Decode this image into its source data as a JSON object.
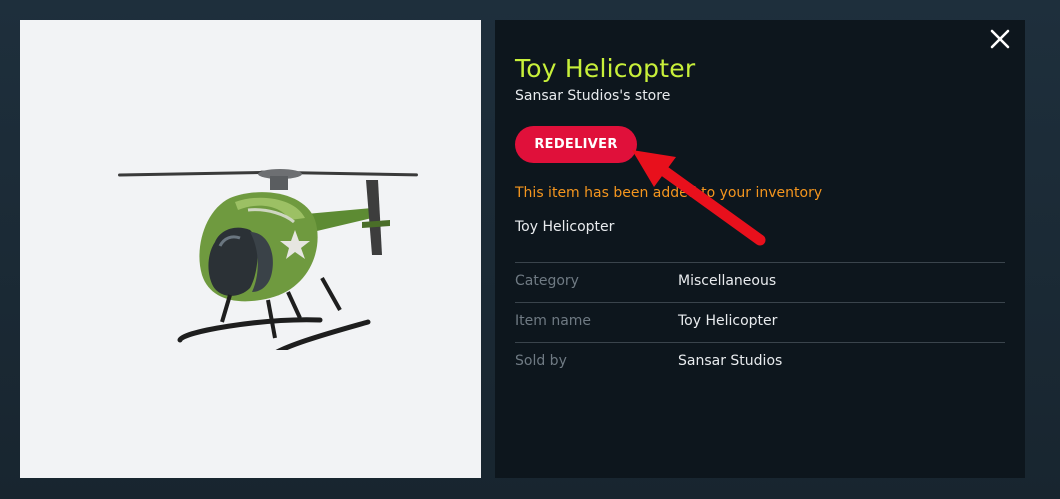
{
  "product": {
    "title": "Toy Helicopter",
    "store": "Sansar Studios's store",
    "redeliver_label": "REDELIVER",
    "notice": "This item has been added to your inventory",
    "item_label": "Toy Helicopter",
    "image_icon": "helicopter-image"
  },
  "details": [
    {
      "key": "Category",
      "value": "Miscellaneous"
    },
    {
      "key": "Item name",
      "value": "Toy Helicopter"
    },
    {
      "key": "Sold by",
      "value": "Sansar Studios"
    }
  ],
  "colors": {
    "title": "#c8f03a",
    "button": "#e0103a",
    "notice": "#f5961e",
    "annotation_arrow": "#e8101c"
  },
  "icons": {
    "close": "close-icon",
    "arrow": "annotation-arrow"
  }
}
